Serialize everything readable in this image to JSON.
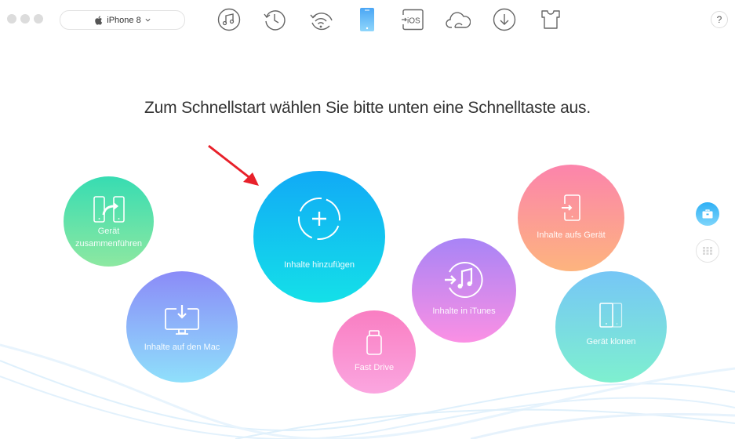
{
  "window": {
    "traffic_lights": [
      "close",
      "minimize",
      "zoom"
    ]
  },
  "toolbar": {
    "device_name": "iPhone 8",
    "device_icon": "apple-icon",
    "dropdown_icon": "chevron-down-icon",
    "icons": [
      {
        "name": "music-icon",
        "label": "Music"
      },
      {
        "name": "history-icon",
        "label": "Backup history"
      },
      {
        "name": "wifi-restore-icon",
        "label": "Wi-Fi"
      },
      {
        "name": "device-icon",
        "label": "Device",
        "active": true
      },
      {
        "name": "to-ios-icon",
        "label": "iOS",
        "text": "iOS"
      },
      {
        "name": "cloud-icon",
        "label": "iCloud"
      },
      {
        "name": "download-icon",
        "label": "Download"
      },
      {
        "name": "shirt-icon",
        "label": "Theme"
      }
    ],
    "help_label": "?"
  },
  "main": {
    "headline": "Zum Schnellstart wählen Sie bitte unten eine Schnelltaste aus.",
    "quick_actions": [
      {
        "id": "merge",
        "label_line1": "Gerät",
        "label_line2": "zusammenführen",
        "icon": "merge-devices-icon",
        "colors": [
          "#37dcb2",
          "#8de8a1"
        ]
      },
      {
        "id": "to-mac",
        "label": "Inhalte auf den Mac",
        "icon": "monitor-download-icon",
        "colors": [
          "#8b8bf8",
          "#8fe0fb"
        ]
      },
      {
        "id": "add",
        "label": "Inhalte hinzufügen",
        "icon": "add-content-icon",
        "colors": [
          "#11aaf6",
          "#14e0e8"
        ]
      },
      {
        "id": "fast-drive",
        "label": "Fast Drive",
        "icon": "usb-drive-icon",
        "colors": [
          "#f97ec2",
          "#fba6e0"
        ]
      },
      {
        "id": "to-itunes",
        "label": "Inhalte in iTunes",
        "icon": "itunes-transfer-icon",
        "colors": [
          "#a884f6",
          "#fb90e4"
        ]
      },
      {
        "id": "to-device",
        "label": "Inhalte aufs Gerät",
        "icon": "phone-import-icon",
        "colors": [
          "#fc84ac",
          "#fdb47e"
        ]
      },
      {
        "id": "clone",
        "label": "Gerät klonen",
        "icon": "clone-device-icon",
        "colors": [
          "#76c6f6",
          "#7ef0cf"
        ]
      }
    ],
    "annotation": "red-arrow-pointing-to-add"
  },
  "side_panel": {
    "buttons": [
      {
        "name": "toolkit-button",
        "icon": "briefcase-icon",
        "active": true,
        "color": "#35b4f6"
      },
      {
        "name": "grid-button",
        "icon": "grid-icon",
        "active": false
      }
    ]
  }
}
